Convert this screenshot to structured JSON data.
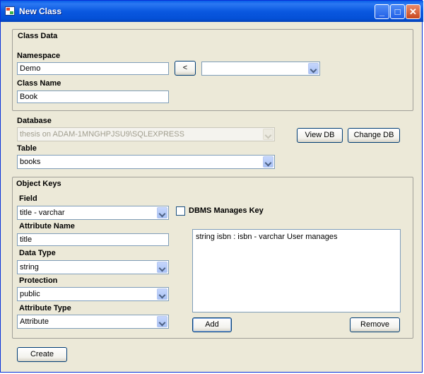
{
  "window": {
    "title": "New Class"
  },
  "titlebar_buttons": {
    "minimize": "_",
    "maximize": "□",
    "close": "✕"
  },
  "class_data": {
    "group_title": "Class Data",
    "namespace_label": "Namespace",
    "namespace_value": "Demo",
    "move_button_label": "<",
    "namespace_dropdown_value": "",
    "class_name_label": "Class Name",
    "class_name_value": "Book"
  },
  "database": {
    "label": "Database",
    "value": "thesis on ADAM-1MNGHPJSU9\\SQLEXPRESS",
    "view_db_label": "View DB",
    "change_db_label": "Change DB",
    "table_label": "Table",
    "table_value": "books"
  },
  "object_keys": {
    "group_title": "Object Keys",
    "field_label": "Field",
    "field_value": "title - varchar",
    "dbms_manages_key_label": "DBMS Manages Key",
    "dbms_manages_key_checked": false,
    "attribute_name_label": "Attribute Name",
    "attribute_name_value": "title",
    "data_type_label": "Data Type",
    "data_type_value": "string",
    "protection_label": "Protection",
    "protection_value": "public",
    "attribute_type_label": "Attribute Type",
    "attribute_type_value": "Attribute",
    "keys": [
      "string isbn : isbn - varchar User manages"
    ],
    "add_label": "Add",
    "remove_label": "Remove"
  },
  "footer": {
    "create_label": "Create"
  }
}
